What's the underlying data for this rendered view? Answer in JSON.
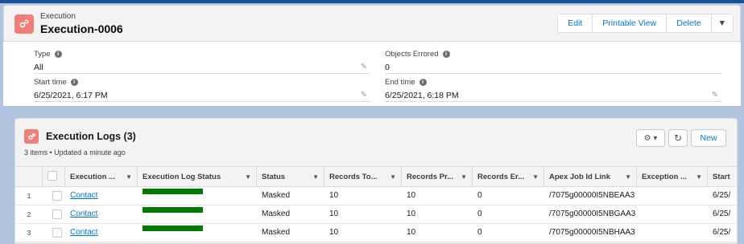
{
  "header": {
    "object_label": "Execution",
    "record_title": "Execution-0006",
    "buttons": [
      "Edit",
      "Printable View",
      "Delete"
    ],
    "more_icon": "chevron-down-icon"
  },
  "details": {
    "left": [
      {
        "label": "Type",
        "value": "All"
      },
      {
        "label": "Start time",
        "value": "6/25/2021, 6:17 PM"
      }
    ],
    "right": [
      {
        "label": "Objects Errored",
        "value": "0"
      },
      {
        "label": "End time",
        "value": "6/25/2021, 6:18 PM"
      }
    ]
  },
  "related": {
    "title": "Execution Logs (3)",
    "subtitle": "3 items • Updated a minute ago",
    "new_label": "New",
    "columns": [
      "Execution ...",
      "Execution Log Status",
      "Status",
      "Records To...",
      "Records Pr...",
      "Records Er...",
      "Apex Job Id Link",
      "Exception ...",
      "Start"
    ],
    "rows": [
      {
        "num": "1",
        "name": "Contact",
        "status": "Masked",
        "total": "10",
        "processed": "10",
        "errored": "0",
        "job": "/7075g00000I5NBEAA3",
        "start": "6/25/"
      },
      {
        "num": "2",
        "name": "Contact",
        "status": "Masked",
        "total": "10",
        "processed": "10",
        "errored": "0",
        "job": "/7075g00000I5NBGAA3",
        "start": "6/25/"
      },
      {
        "num": "3",
        "name": "Contact",
        "status": "Masked",
        "total": "10",
        "processed": "10",
        "errored": "0",
        "job": "/7075g00000I5NBHAA3",
        "start": "6/25/"
      }
    ],
    "status_bar_color": "#007a00"
  },
  "colors": {
    "accent": "#0176d3",
    "icon": "#f27e79"
  }
}
